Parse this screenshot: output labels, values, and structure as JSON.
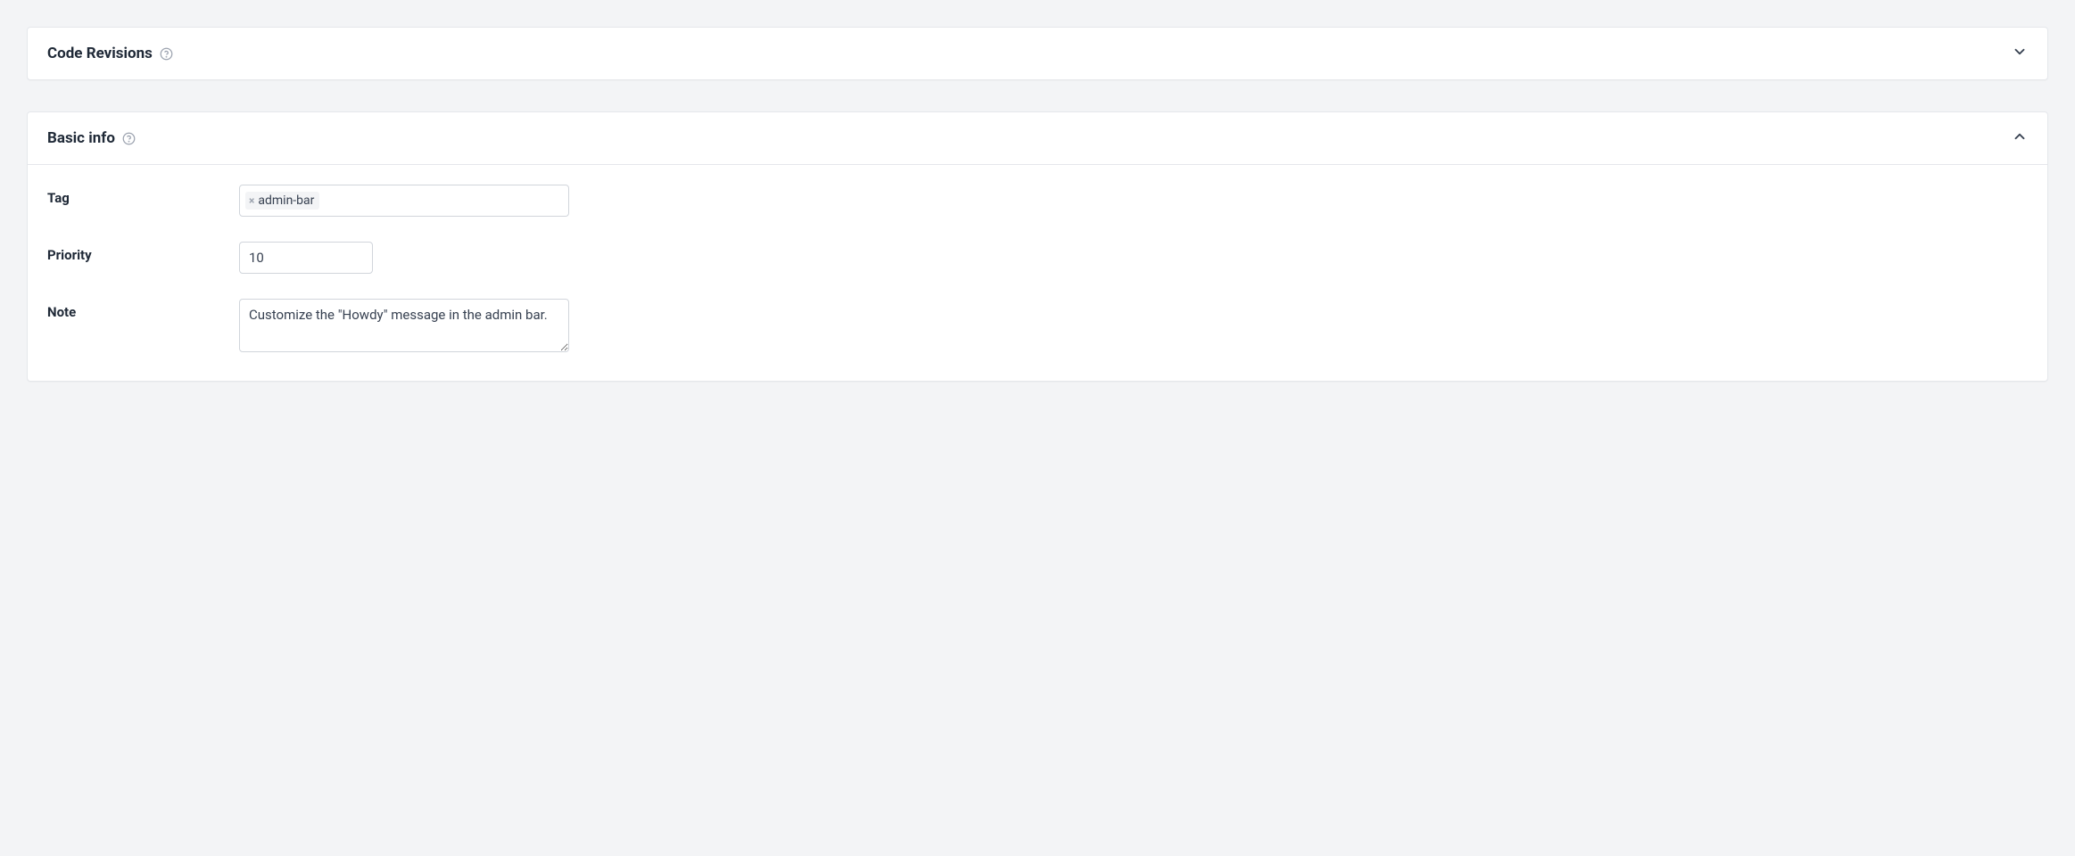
{
  "panels": {
    "code_revisions": {
      "title": "Code Revisions",
      "expanded": false
    },
    "basic_info": {
      "title": "Basic info",
      "expanded": true,
      "fields": {
        "tag": {
          "label": "Tag",
          "chips": [
            "admin-bar"
          ]
        },
        "priority": {
          "label": "Priority",
          "value": "10"
        },
        "note": {
          "label": "Note",
          "value": "Customize the \"Howdy\" message in the admin bar."
        }
      }
    }
  }
}
